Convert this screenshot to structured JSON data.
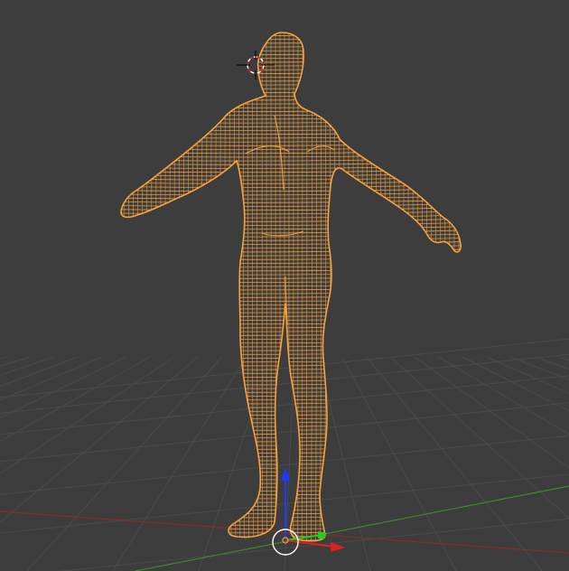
{
  "viewport": {
    "background": "#3d3d3d",
    "grid_color": "#4a4a4a",
    "x_axis_color": "#8a2a2a",
    "y_axis_color": "#3f8a2a"
  },
  "model": {
    "display_mode": "wireframe",
    "selected": true,
    "wire_color": "#f5a13c",
    "shape": "human-figure-a-pose"
  },
  "gizmo": {
    "z_color": "#1a3cff",
    "y_color": "#22cc22",
    "x_color": "#e02020",
    "origin_color": "#f5a13c"
  },
  "cursor_3d": {
    "ring_colors": [
      "#ffffff",
      "#d62828"
    ],
    "crosshair_color": "#000000"
  }
}
